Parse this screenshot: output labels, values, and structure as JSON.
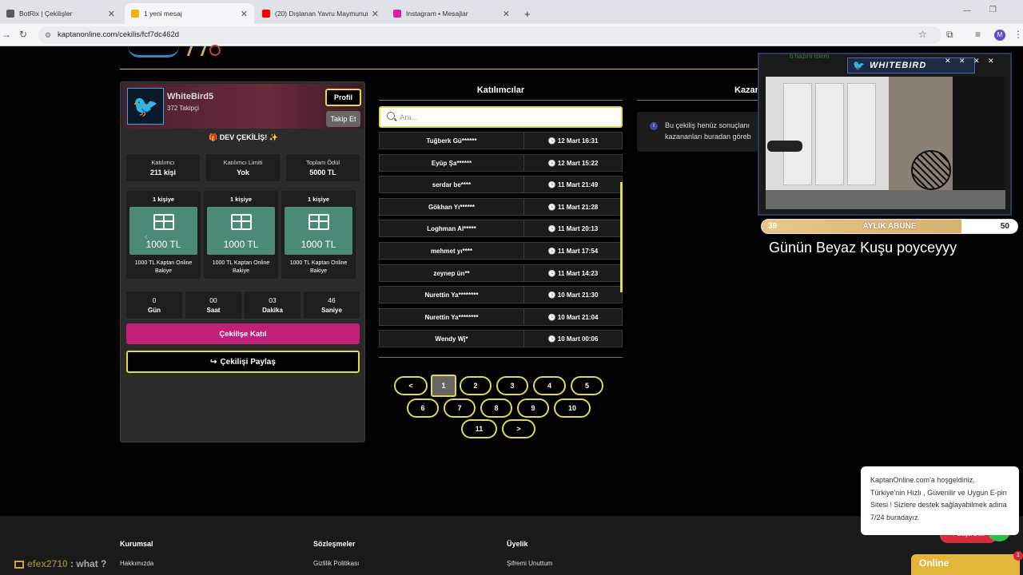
{
  "browser": {
    "tabs": [
      {
        "label": "BotRix | Çekilişler",
        "color": "#5a5a5a"
      },
      {
        "label": "1 yeni mesaj",
        "color": "#f0b400"
      },
      {
        "label": "(20) Dışlanan Yavru Maymunun",
        "color": "#ff0000"
      },
      {
        "label": "Instagram • Mesajlar",
        "color": "#d6249f"
      }
    ],
    "new_tab": "+",
    "url": "kaptanonline.com/cekilis/fcf7dc462d",
    "profile_initial": "M"
  },
  "profile": {
    "username": "WhiteBird5",
    "followers": "372 Takipçi",
    "profile_button": "Profil",
    "follow_button": "Takip Et"
  },
  "giveaway": {
    "title": "🎁 DEV ÇEKİLİŞ! ✨",
    "stats": [
      {
        "label": "Katılımcı",
        "value": "211 kişi"
      },
      {
        "label": "Katılımcı Limiti",
        "value": "Yok"
      },
      {
        "label": "Toplam Ödül",
        "value": "5000 TL"
      }
    ],
    "prizes": [
      {
        "count": "1 kişiye",
        "amount": "1000 TL",
        "desc": "1000 TL Kaptan Online Bakiye"
      },
      {
        "count": "1 kişiye",
        "amount": "1000 TL",
        "desc": "1000 TL Kaptan Online Bakiye"
      },
      {
        "count": "1 kişiye",
        "amount": "1000 TL",
        "desc": "1000 TL Kaptan Online Bakiye"
      }
    ],
    "countdown": [
      {
        "value": "0",
        "unit": "Gün"
      },
      {
        "value": "00",
        "unit": "Saat"
      },
      {
        "value": "03",
        "unit": "Dakika"
      },
      {
        "value": "46",
        "unit": "Saniye"
      }
    ],
    "join_button": "Çekilişe Katıl",
    "share_button": "Çekilişi Paylaş"
  },
  "participants": {
    "title": "Katılımcılar",
    "search_placeholder": "Ara...",
    "rows": [
      {
        "name": "Tuğberk Gü******",
        "date": "12 Mart 16:31"
      },
      {
        "name": "Eyüp Şa******",
        "date": "12 Mart 15:22"
      },
      {
        "name": "serdar be****",
        "date": "11 Mart 21:49"
      },
      {
        "name": "Gökhan Yı******",
        "date": "11 Mart 21:28"
      },
      {
        "name": "Loghman Al*****",
        "date": "11 Mart 20:13"
      },
      {
        "name": "mehmet yı****",
        "date": "11 Mart 17:54"
      },
      {
        "name": "zeynep ün**",
        "date": "11 Mart 14:23"
      },
      {
        "name": "Nurettin Ya********",
        "date": "10 Mart 21:30"
      },
      {
        "name": "Nurettin Ya********",
        "date": "10 Mart 21:04"
      },
      {
        "name": "Wendy Wj*",
        "date": "10 Mart 00:06"
      }
    ],
    "pagination": {
      "row1": [
        "<",
        "1",
        "2",
        "3",
        "4",
        "5"
      ],
      "row2": [
        "6",
        "7",
        "8",
        "9",
        "10"
      ],
      "row3": [
        "11",
        ">"
      ],
      "current": "1"
    }
  },
  "winners": {
    "title": "Kazan",
    "info_line1": "Bu çekiliş henüz sonuçlanı",
    "info_line2": "kazananları buradan göreb"
  },
  "stream": {
    "brand": "WHITEBIRD",
    "close_marks": "✕ ✕ ✕ ✕",
    "top_text": "6 hazırlı islem",
    "sub_left": "39",
    "sub_label": "AYLIK ABUNE",
    "sub_right": "50",
    "sub_progress": 0.78,
    "message": "Günün Beyaz Kuşu poyceyyy"
  },
  "footer": {
    "columns": [
      {
        "title": "Kurumsal",
        "link": "Hakkımızda"
      },
      {
        "title": "Sözleşmeler",
        "link": "Gizlilik Politikası"
      },
      {
        "title": "Üyelik",
        "link": "Şifremi Unuttum"
      }
    ]
  },
  "chat": {
    "user": "efex2710",
    "message": ": what ?"
  },
  "welcome": {
    "text": "KaptanOnline.com'a hoşgeldiniz. Türkiye'nin Hızlı , Güvenilir ve Uygun E-pin Sitesi ! Sizlere destek sağlayabilmek adına 7/24 buradayız."
  },
  "widgets": {
    "basa_don": "Başa Dön",
    "online": "Online",
    "online_badge": "1"
  },
  "colors": {
    "accent_yellow": "#e3d94a",
    "join_pink": "#c21f7b",
    "prize_green": "#4c8a78",
    "online_gold": "#e2b63a"
  }
}
